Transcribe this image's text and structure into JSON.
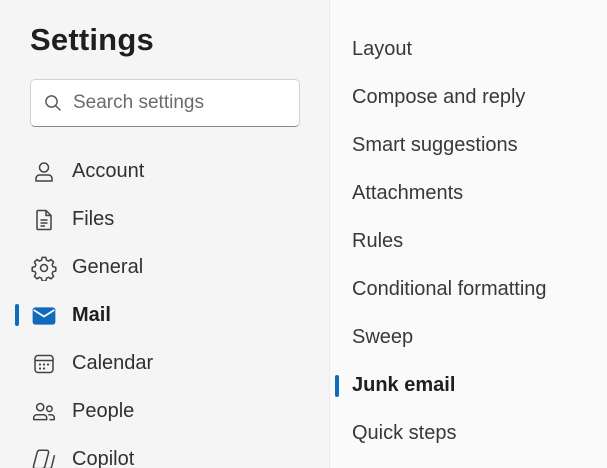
{
  "settings": {
    "title": "Settings",
    "search_placeholder": "Search settings"
  },
  "nav": {
    "items": [
      {
        "label": "Account",
        "icon": "person-icon"
      },
      {
        "label": "Files",
        "icon": "document-icon"
      },
      {
        "label": "General",
        "icon": "gear-icon"
      },
      {
        "label": "Mail",
        "icon": "mail-icon",
        "selected": true
      },
      {
        "label": "Calendar",
        "icon": "calendar-icon"
      },
      {
        "label": "People",
        "icon": "people-icon"
      },
      {
        "label": "Copilot",
        "icon": "copilot-icon"
      }
    ]
  },
  "mail_sections": {
    "items": [
      {
        "label": "Layout"
      },
      {
        "label": "Compose and reply"
      },
      {
        "label": "Smart suggestions"
      },
      {
        "label": "Attachments"
      },
      {
        "label": "Rules"
      },
      {
        "label": "Conditional formatting"
      },
      {
        "label": "Sweep"
      },
      {
        "label": "Junk email",
        "selected": true
      },
      {
        "label": "Quick steps"
      }
    ]
  },
  "colors": {
    "accent": "#0f6cbd",
    "text": "#242424",
    "pane_left": "#f5f5f5",
    "pane_right": "#fafafa"
  }
}
